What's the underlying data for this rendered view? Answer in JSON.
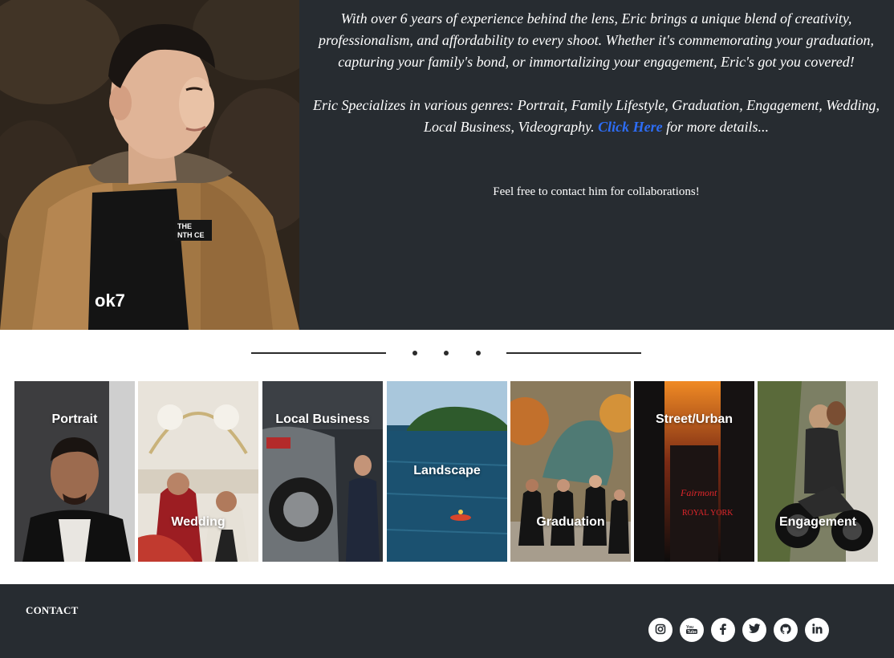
{
  "hero": {
    "paragraph1": "With over 6 years of experience behind the lens, Eric brings a unique blend of creativity, professionalism, and affordability to every shoot. Whether it's commemorating your graduation, capturing your family's bond, or immortalizing your engagement, Eric's got you covered!",
    "paragraph2_before": "Eric Specializes in various genres: Portrait, Family Lifestyle, Graduation, Engagement, Wedding, Local Business, Videography. ",
    "paragraph2_link": "Click Here",
    "paragraph2_after": " for more details...",
    "contact_line": "Feel free to contact him for collaborations!",
    "link_color": "#2d6df6",
    "background": "#272c31"
  },
  "gallery": {
    "tiles": [
      {
        "label": "Portrait"
      },
      {
        "label": "Wedding"
      },
      {
        "label": "Local Business"
      },
      {
        "label": "Landscape"
      },
      {
        "label": "Graduation"
      },
      {
        "label": "Street/Urban"
      },
      {
        "label": "Engagement"
      }
    ]
  },
  "footer": {
    "title": "CONTACT",
    "social": [
      {
        "icon": "instagram-icon",
        "glyph": "◎"
      },
      {
        "icon": "youtube-icon",
        "glyph": "▶"
      },
      {
        "icon": "facebook-icon",
        "glyph": "f"
      },
      {
        "icon": "twitter-icon",
        "glyph": "✦"
      },
      {
        "icon": "github-icon",
        "glyph": "◍"
      },
      {
        "icon": "linkedin-icon",
        "glyph": "in"
      }
    ]
  }
}
